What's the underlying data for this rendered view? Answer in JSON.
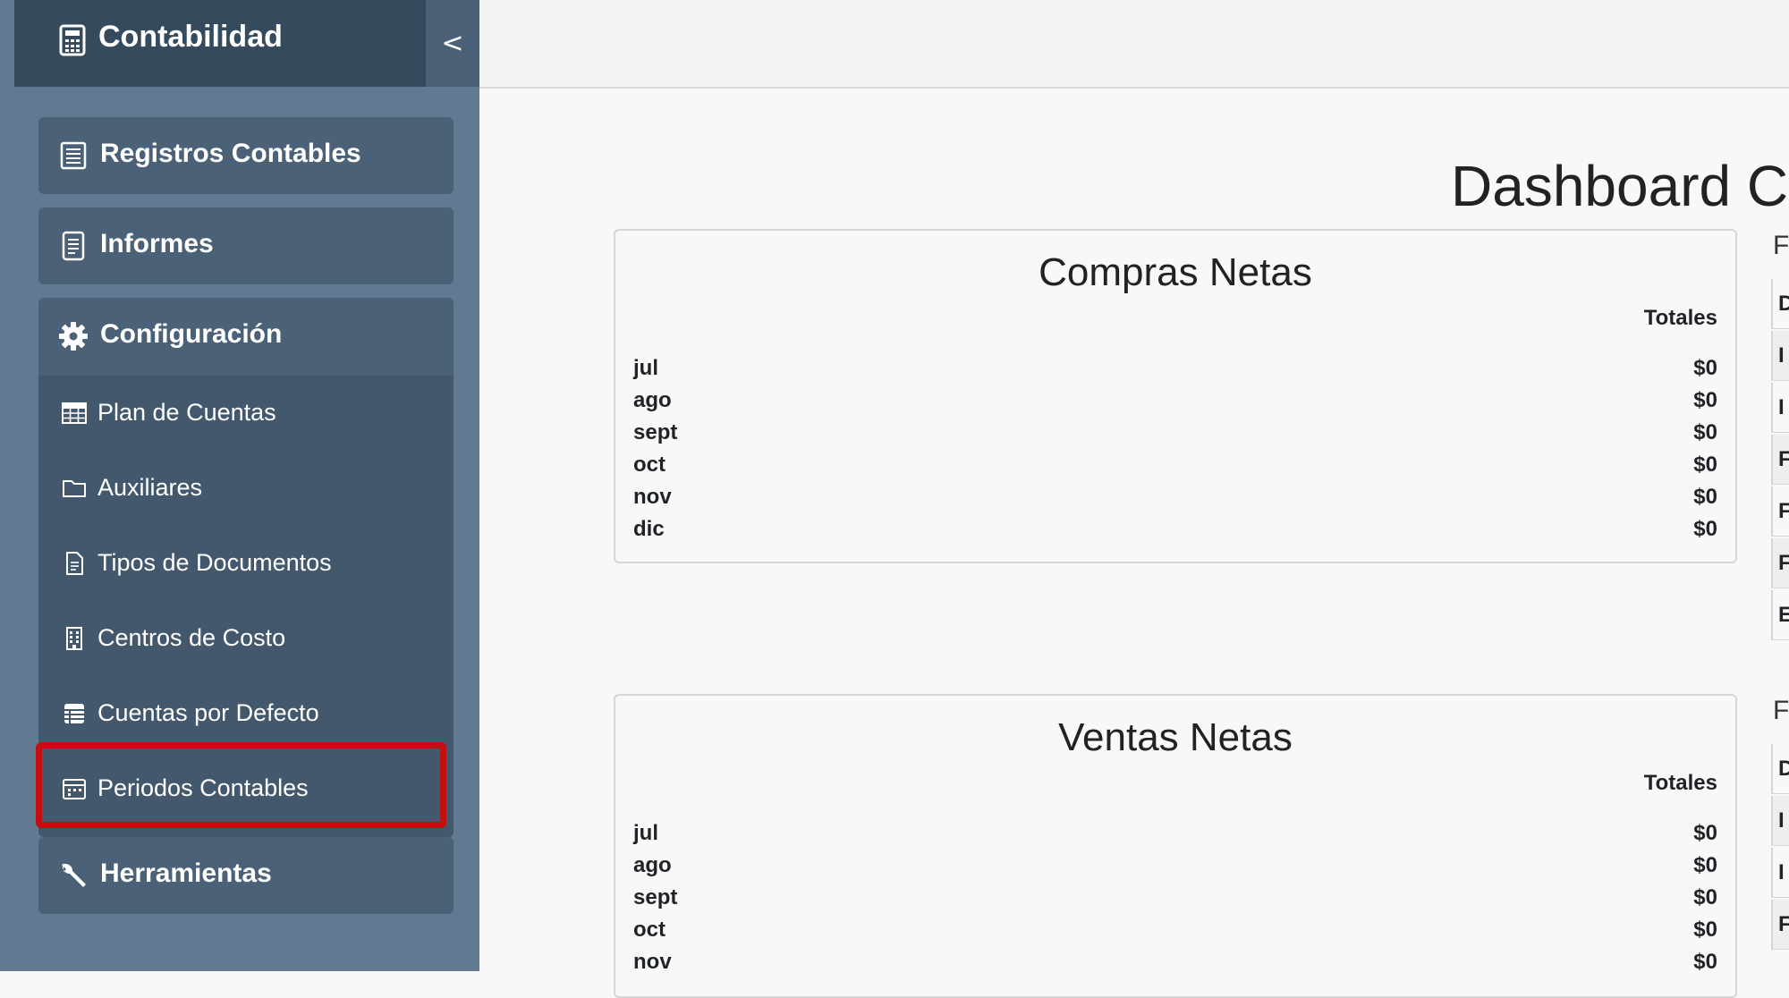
{
  "sidebar": {
    "brand": "Contabilidad",
    "collapse": "<",
    "items": [
      {
        "label": "Registros Contables",
        "icon": "ledger-icon"
      },
      {
        "label": "Informes",
        "icon": "document-icon"
      },
      {
        "label": "Configuración",
        "icon": "gear-icon"
      },
      {
        "label": "Herramientas",
        "icon": "wrench-icon"
      }
    ],
    "submenu": [
      {
        "label": "Plan de Cuentas",
        "icon": "table-icon"
      },
      {
        "label": "Auxiliares",
        "icon": "folder-icon"
      },
      {
        "label": "Tipos de Documentos",
        "icon": "file-icon"
      },
      {
        "label": "Centros de Costo",
        "icon": "building-icon"
      },
      {
        "label": "Cuentas por Defecto",
        "icon": "list-icon"
      },
      {
        "label": "Periodos Contables",
        "icon": "calendar-icon"
      }
    ]
  },
  "main": {
    "page_title": "Dashboard Co",
    "compras": {
      "title": "Compras Netas",
      "column": "Totales",
      "rows": [
        {
          "month": "jul",
          "value": "$0"
        },
        {
          "month": "ago",
          "value": "$0"
        },
        {
          "month": "sept",
          "value": "$0"
        },
        {
          "month": "oct",
          "value": "$0"
        },
        {
          "month": "nov",
          "value": "$0"
        },
        {
          "month": "dic",
          "value": "$0"
        }
      ]
    },
    "ventas": {
      "title": "Ventas Netas",
      "column": "Totales",
      "rows": [
        {
          "month": "jul",
          "value": "$0"
        },
        {
          "month": "ago",
          "value": "$0"
        },
        {
          "month": "sept",
          "value": "$0"
        },
        {
          "month": "oct",
          "value": "$0"
        },
        {
          "month": "nov",
          "value": "$0"
        }
      ]
    },
    "right_fragment": {
      "heading1": "F",
      "cells1": [
        "D",
        "I",
        "I",
        "F",
        "F",
        "F",
        "E"
      ],
      "heading2": "F",
      "cells2": [
        "D",
        "I",
        "I",
        "F"
      ]
    }
  },
  "colors": {
    "sidebar_bg": "#617a92",
    "brand_bg": "#354a5c",
    "item_bg": "#4b6178",
    "submenu_bg": "#44586d",
    "highlight": "#c10f12"
  }
}
